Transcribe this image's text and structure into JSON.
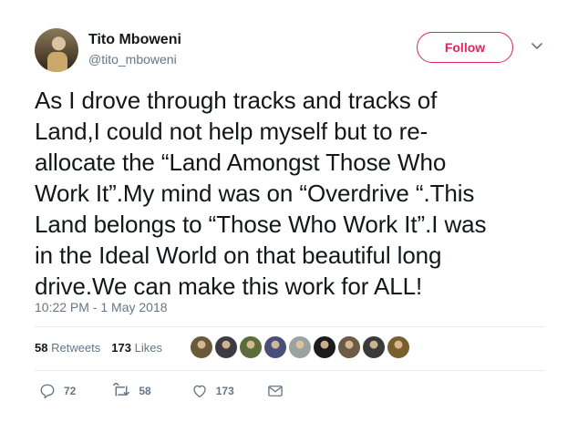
{
  "user": {
    "name": "Tito Mboweni",
    "handle": "@tito_mboweni"
  },
  "follow_label": "Follow",
  "tweet_text": "As I drove through tracks and tracks of\nLand,I could not help myself but to re-\nallocate the “Land Amongst Those Who\nWork It”.My mind was on “Overdrive “.This\nLand belongs to “Those Who Work It”.I was\nin the Ideal World on that beautiful long\ndrive.We  can make this work for ALL!",
  "timestamp": "10:22 PM - 1 May 2018",
  "stats": {
    "retweets_count": "58",
    "retweets_label": "Retweets",
    "likes_count": "173",
    "likes_label": "Likes"
  },
  "likers": [
    {
      "icon": "liker-avatar-1",
      "color": "#6b5a3a"
    },
    {
      "icon": "liker-avatar-2",
      "color": "#3d3a44"
    },
    {
      "icon": "liker-avatar-3",
      "color": "#5e6b3b"
    },
    {
      "icon": "liker-avatar-4",
      "color": "#4a4f7a"
    },
    {
      "icon": "liker-avatar-5",
      "color": "#9aa3a0"
    },
    {
      "icon": "liker-avatar-6",
      "color": "#1c1c1c"
    },
    {
      "icon": "liker-avatar-7",
      "color": "#6e5b46"
    },
    {
      "icon": "liker-avatar-8",
      "color": "#3a3a3a"
    },
    {
      "icon": "liker-avatar-9",
      "color": "#7a5f2e"
    }
  ],
  "actions": {
    "replies": "72",
    "retweets": "58",
    "likes": "173"
  },
  "colors": {
    "follow_accent": "#e0245e",
    "muted": "#657786",
    "text": "#14171a",
    "divider": "#e6ecf0"
  },
  "icons": {
    "reply": "reply-icon",
    "retweet": "retweet-icon",
    "like": "heart-icon",
    "dm": "envelope-icon",
    "more": "chevron-down-icon"
  }
}
